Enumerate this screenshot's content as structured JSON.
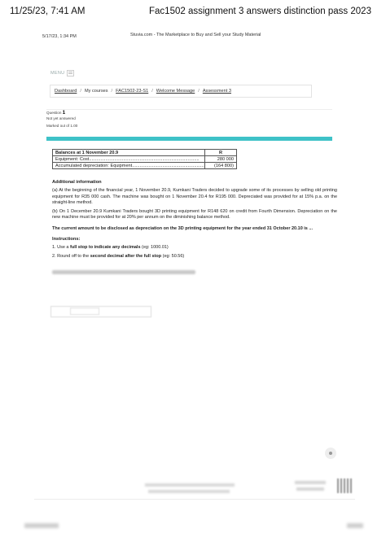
{
  "print_header": {
    "datetime": "11/25/23, 7:41 AM",
    "title": "Fac1502 assignment 3 answers distinction pass 2023"
  },
  "sub_header": {
    "datetime": "5/17/23, 1:34 PM",
    "source": "Stuvia.com - The Marketplace to Buy and Sell your Study Material"
  },
  "menu": {
    "label": "MENU"
  },
  "breadcrumb": {
    "items": [
      "Dashboard",
      "My courses",
      "FAC1502-23-S1",
      "Welcome Message",
      "Assessment 3"
    ]
  },
  "question_info": {
    "label": "Question",
    "number": "1",
    "status": "Not yet answered",
    "marks": "Marked out of 1.00"
  },
  "balances_table": {
    "header": "Balances at 1 November 20.9",
    "currency": "R",
    "rows": [
      {
        "label": "Equipment: Cost.......................................................................................",
        "value": "280 000"
      },
      {
        "label": "Accumulated depreciation: Equipment............................................................",
        "value": "(164 800)"
      }
    ]
  },
  "content": {
    "heading": "Additional information",
    "para_a": "(a)  At the beginning of the financial year, 1 November 20.9, Kumkani Traders decided to upgrade some of its processes by selling old printing equipment for R35 000 cash. The machine was bought on 1 November 20.4 for R195 000. Depreciated was provided for at 15% p.a. on the straight-line method.",
    "para_b": "(b)  On 1 December 20.9 Kumkani Traders bought 3D printing equipment for R148 620 on credit from Fourth Dimension. Depreciation on the new machine must be provided for at 20% per annum on the diminishing balance method.",
    "question": "The current amount to be disclosed as depreciation on the 3D printing equipment for the year ended 31 October 20.10 is ...",
    "instructions_heading": "Instructions:",
    "instruction_1_pre": "1. Use a ",
    "instruction_1_bold": "full stop to indicate any decimals",
    "instruction_1_post": " (eg: 1000.01)",
    "instruction_2_pre": "2.  Round off to the ",
    "instruction_2_bold": "second decimal after the full stop",
    "instruction_2_post": " (eg: 50.56)"
  },
  "colors": {
    "accent": "#3fc2c8"
  }
}
